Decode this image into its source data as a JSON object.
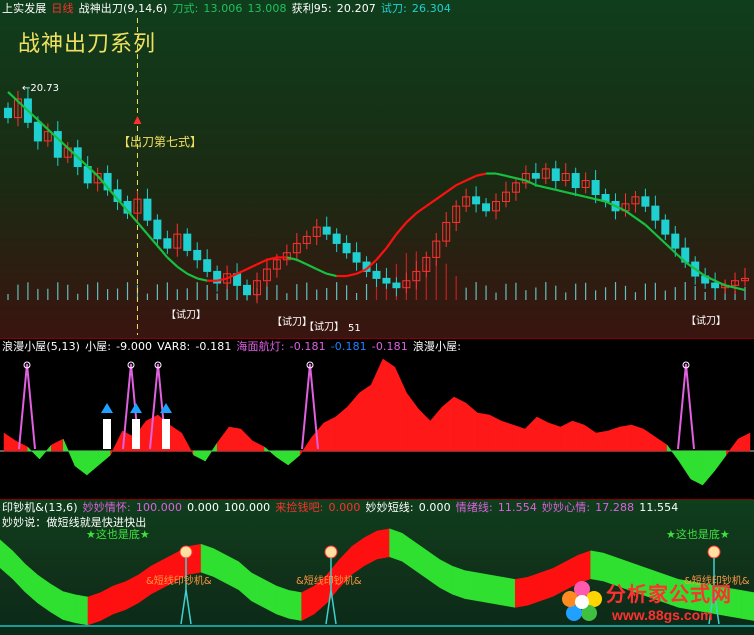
{
  "colors": {
    "up": "#ff3030",
    "down": "#20d0d0",
    "green_line": "#18c040",
    "red_line": "#ff1010",
    "yellow": "#f0e060",
    "magenta": "#e060e0",
    "white": "#ffffff",
    "blue": "#2080ff"
  },
  "pane1": {
    "header": {
      "name": "上实发展",
      "period": "日线",
      "indicator": "战神出刀(9,14,6)",
      "knife_label": "刀式:",
      "knife_v1": "13.006",
      "knife_v2": "13.008",
      "profit_label": "获利95:",
      "profit_value": "20.207",
      "trial_label": "试刀:",
      "trial_value": "26.304"
    },
    "big_title": "战神出刀系列",
    "high_marker": "20.73",
    "annotation": "【出刀第七式】",
    "trial_tags": [
      "【试刀】",
      "【试刀】",
      "【试刀】",
      "【试刀】"
    ],
    "low_value": "51"
  },
  "pane2": {
    "header": {
      "name": "浪漫小屋(5,13)",
      "house_label": "小屋:",
      "house_value": "-9.000",
      "var8_label": "VAR8:",
      "var8_value": "-0.181",
      "lamp_label": "海面航灯:",
      "lamp_value": "-0.181",
      "blue_value": "-0.181",
      "pink_value": "-0.181",
      "tail_label": "浪漫小屋:"
    }
  },
  "pane3": {
    "header": {
      "name": "印钞机&(13,6)",
      "f1_label": "妙妙情怀:",
      "f1_value": "100.000",
      "f2_value": "0.000",
      "f3_value": "100.000",
      "f4_label": "来捡钱吧:",
      "f4_value": "0.000",
      "f5_label": "妙妙短线:",
      "f5_value": "0.000",
      "f6_label": "情绪线:",
      "f6_value": "11.554",
      "f7_label": "妙妙心情:",
      "f7_value": "17.288",
      "f8_value": "11.554"
    },
    "subtitle": "妙妙说：做短线就是快进快出",
    "bottom_tags": [
      "★这也是底★",
      "★这也是底★"
    ],
    "machine_tags": [
      "&短线印钞机&",
      "&短线印钞机&",
      "&短线印钞机&"
    ]
  },
  "watermark": {
    "title": "分析家公式网",
    "url": "www.88gs.com"
  },
  "chart_data": [
    {
      "type": "candlestick",
      "title": "战神出刀",
      "series": [
        {
          "name": "close",
          "values": [
            19.6,
            20.4,
            19.4,
            18.6,
            19.0,
            17.9,
            18.3,
            17.5,
            16.8,
            17.2,
            16.5,
            16.0,
            15.5,
            16.1,
            15.2,
            14.4,
            14.0,
            14.6,
            13.9,
            13.5,
            13.0,
            12.5,
            12.9,
            12.4,
            12.0,
            12.6,
            13.1,
            13.5,
            13.8,
            14.2,
            14.5,
            14.9,
            14.6,
            14.2,
            13.8,
            13.4,
            13.0,
            12.7,
            12.5,
            12.3,
            12.6,
            13.0,
            13.6,
            14.3,
            15.1,
            15.8,
            16.2,
            15.9,
            15.6,
            16.0,
            16.4,
            16.8,
            17.2,
            17.0,
            17.4,
            16.9,
            17.2,
            16.6,
            16.9,
            16.3,
            16.0,
            15.6,
            15.9,
            16.2,
            15.8,
            15.2,
            14.6,
            14.0,
            13.4,
            12.8,
            12.5,
            12.3,
            12.4,
            12.6,
            12.7
          ]
        },
        {
          "name": "ma",
          "values": [
            20.7,
            20.3,
            19.9,
            19.5,
            19.1,
            18.7,
            18.3,
            17.9,
            17.5,
            17.1,
            16.6,
            16.1,
            15.6,
            15.1,
            14.6,
            14.1,
            13.6,
            13.2,
            12.9,
            12.7,
            12.6,
            12.6,
            12.7,
            12.9,
            13.1,
            13.3,
            13.5,
            13.6,
            13.6,
            13.5,
            13.3,
            13.1,
            12.9,
            12.8,
            12.8,
            12.9,
            13.1,
            13.5,
            14.0,
            14.6,
            15.1,
            15.5,
            15.8,
            16.1,
            16.4,
            16.7,
            16.9,
            17.1,
            17.2,
            17.2,
            17.1,
            17.0,
            16.9,
            16.7,
            16.6,
            16.5,
            16.4,
            16.3,
            16.2,
            16.1,
            16.0,
            15.8,
            15.6,
            15.3,
            15.0,
            14.6,
            14.2,
            13.8,
            13.4,
            13.1,
            12.8,
            12.6,
            12.4,
            12.3,
            12.2
          ]
        }
      ]
    },
    {
      "type": "area",
      "title": "浪漫小屋",
      "series": [
        {
          "name": "osc",
          "values": [
            18,
            10,
            4,
            -8,
            6,
            12,
            -15,
            -24,
            -14,
            -4,
            20,
            14,
            30,
            36,
            26,
            18,
            -4,
            -10,
            8,
            24,
            22,
            10,
            4,
            -6,
            -14,
            -4,
            14,
            28,
            34,
            44,
            58,
            66,
            92,
            84,
            58,
            42,
            30,
            44,
            54,
            48,
            38,
            36,
            30,
            26,
            22,
            34,
            28,
            24,
            30,
            26,
            18,
            20,
            24,
            26,
            22,
            14,
            6,
            -10,
            -28,
            -34,
            -20,
            -4,
            12,
            18
          ]
        }
      ]
    },
    {
      "type": "area",
      "title": "印钞机",
      "series": [
        {
          "name": "wave",
          "values": [
            62,
            52,
            40,
            30,
            22,
            15,
            12,
            10,
            14,
            20,
            24,
            30,
            38,
            44,
            50,
            56,
            58,
            54,
            48,
            42,
            32,
            26,
            20,
            16,
            14,
            20,
            30,
            44,
            56,
            64,
            70,
            72,
            68,
            60,
            52,
            44,
            38,
            34,
            32,
            30,
            28,
            26,
            28,
            32,
            36,
            42,
            48,
            52,
            50,
            46,
            42,
            38,
            34,
            30,
            26,
            24,
            22,
            20,
            18,
            16,
            14
          ]
        }
      ]
    }
  ]
}
